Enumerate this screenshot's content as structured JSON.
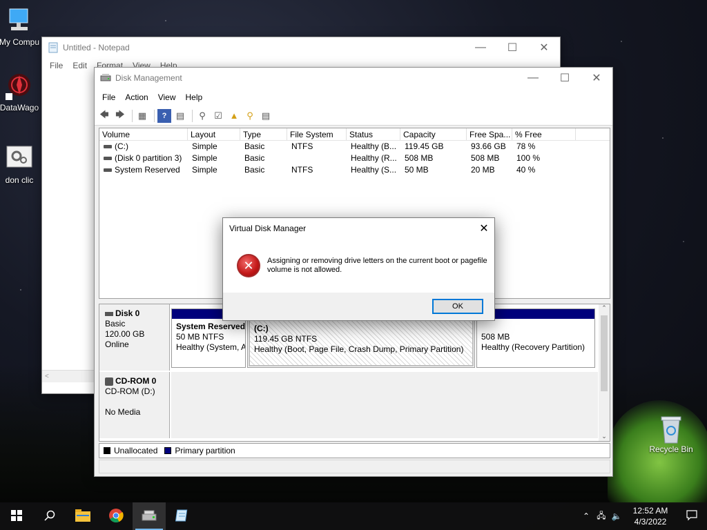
{
  "desktop": {
    "icons": [
      {
        "label": "My Compu"
      },
      {
        "label": "DataWago"
      },
      {
        "label": "don clic"
      },
      {
        "label": "Recycle Bin"
      }
    ]
  },
  "notepad": {
    "title": "Untitled - Notepad",
    "menu": [
      "File",
      "Edit",
      "Format",
      "View",
      "Help"
    ]
  },
  "diskmgmt": {
    "title": "Disk Management",
    "menu": [
      "File",
      "Action",
      "View",
      "Help"
    ],
    "columns": [
      "Volume",
      "Layout",
      "Type",
      "File System",
      "Status",
      "Capacity",
      "Free Spa...",
      "% Free"
    ],
    "volumes": [
      {
        "volume": "(C:)",
        "layout": "Simple",
        "type": "Basic",
        "fs": "NTFS",
        "status": "Healthy (B...",
        "capacity": "119.45 GB",
        "free": "93.66 GB",
        "pct": "78 %"
      },
      {
        "volume": "(Disk 0 partition 3)",
        "layout": "Simple",
        "type": "Basic",
        "fs": "",
        "status": "Healthy (R...",
        "capacity": "508 MB",
        "free": "508 MB",
        "pct": "100 %"
      },
      {
        "volume": "System Reserved",
        "layout": "Simple",
        "type": "Basic",
        "fs": "NTFS",
        "status": "Healthy (S...",
        "capacity": "50 MB",
        "free": "20 MB",
        "pct": "40 %"
      }
    ],
    "disk0": {
      "name": "Disk 0",
      "type": "Basic",
      "size": "120.00 GB",
      "state": "Online",
      "partitions": [
        {
          "name": "System Reserved",
          "size": "50 MB NTFS",
          "status": "Healthy (System, A"
        },
        {
          "name": "(C:)",
          "size": "119.45 GB NTFS",
          "status": "Healthy (Boot, Page File, Crash Dump, Primary Partition)"
        },
        {
          "name": "",
          "size": "508 MB",
          "status": "Healthy (Recovery Partition)"
        }
      ]
    },
    "cdrom0": {
      "name": "CD-ROM 0",
      "drive": "CD-ROM (D:)",
      "media": "No Media"
    },
    "legend": {
      "unallocated": "Unallocated",
      "primary": "Primary partition"
    }
  },
  "dialog": {
    "title": "Virtual Disk Manager",
    "message": "Assigning or removing drive letters on the current boot or pagefile  volume is not allowed.",
    "ok_label": "OK"
  },
  "taskbar": {
    "time": "12:52 AM",
    "date": "4/3/2022"
  },
  "colors": {
    "primary_partition": "#00007c",
    "accent": "#0078d7",
    "error": "#c31818"
  }
}
